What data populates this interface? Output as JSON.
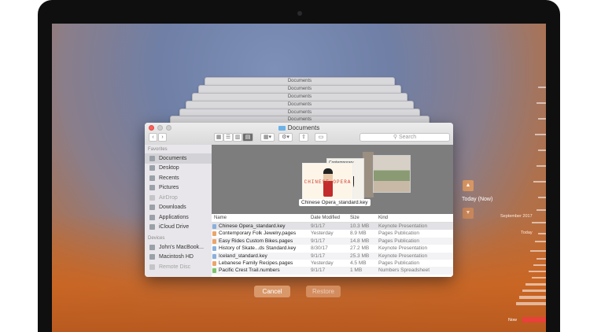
{
  "window": {
    "title": "Documents",
    "search_placeholder": "Search"
  },
  "stack_title": "Documents",
  "sidebar": {
    "favorites_label": "Favorites",
    "favorites": [
      {
        "label": "Documents",
        "icon": "documents-icon",
        "selected": true
      },
      {
        "label": "Desktop",
        "icon": "desktop-icon"
      },
      {
        "label": "Recents",
        "icon": "clock-icon"
      },
      {
        "label": "Pictures",
        "icon": "pictures-icon"
      },
      {
        "label": "AirDrop",
        "icon": "airdrop-icon",
        "dimmed": true
      },
      {
        "label": "Downloads",
        "icon": "downloads-icon"
      },
      {
        "label": "Applications",
        "icon": "applications-icon"
      },
      {
        "label": "iCloud Drive",
        "icon": "cloud-icon"
      }
    ],
    "devices_label": "Devices",
    "devices": [
      {
        "label": "John's MacBook...",
        "icon": "laptop-icon"
      },
      {
        "label": "Macintosh HD",
        "icon": "disk-icon"
      },
      {
        "label": "Remote Disc",
        "icon": "disc-icon",
        "dimmed": true
      }
    ]
  },
  "preview": {
    "doc1_text": "CHINESE OPERA",
    "doc2_text": "Contemporary Folk Jewelry",
    "caption": "Chinese Opera_standard.key"
  },
  "list": {
    "columns": [
      "Name",
      "Date Modified",
      "Size",
      "Kind"
    ],
    "rows": [
      {
        "name": "Chinese Opera_standard.key",
        "date": "9/1/17",
        "size": "10.3 MB",
        "kind": "Keynote Presentation"
      },
      {
        "name": "Contemporary Folk Jewelry.pages",
        "date": "Yesterday",
        "size": "8.9 MB",
        "kind": "Pages Publication"
      },
      {
        "name": "Easy Rides Custom Bikes.pages",
        "date": "9/1/17",
        "size": "14.8 MB",
        "kind": "Pages Publication"
      },
      {
        "name": "History of Skate...ds Standard.key",
        "date": "8/30/17",
        "size": "27.2 MB",
        "kind": "Keynote Presentation"
      },
      {
        "name": "Iceland_standard.key",
        "date": "9/1/17",
        "size": "25.3 MB",
        "kind": "Keynote Presentation"
      },
      {
        "name": "Lebanese Family Recipes.pages",
        "date": "Yesterday",
        "size": "4.5 MB",
        "kind": "Pages Publication"
      },
      {
        "name": "Pacific Crest Trail.numbers",
        "date": "9/1/17",
        "size": "1 MB",
        "kind": "Numbers Spreadsheet"
      }
    ]
  },
  "buttons": {
    "cancel": "Cancel",
    "restore": "Restore"
  },
  "timeline": {
    "now_label": "Today (Now)",
    "marks": [
      "September 2017",
      "Today",
      "Now"
    ],
    "accent": "#e8403a"
  }
}
